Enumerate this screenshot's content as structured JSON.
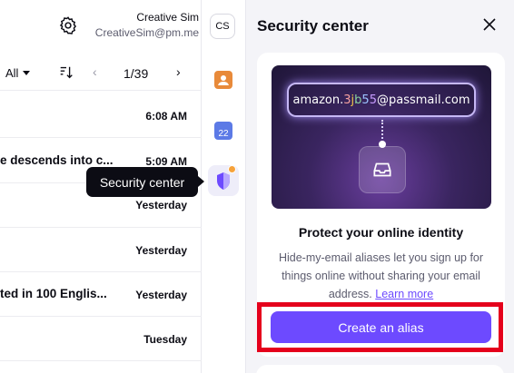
{
  "user": {
    "name": "Creative Sim",
    "email": "CreativeSim@pm.me",
    "initials": "CS"
  },
  "toolbar": {
    "filter": "All",
    "pager": "1/39",
    "prev": "‹",
    "next": "›"
  },
  "mail_rows": [
    {
      "subject": "",
      "time": "6:08 AM"
    },
    {
      "subject": "e descends into c...",
      "time": "5:09 AM"
    },
    {
      "subject": "",
      "time": "Yesterday"
    },
    {
      "subject": "",
      "time": "Yesterday"
    },
    {
      "subject": "ted in 100 Englis...",
      "time": "Yesterday"
    },
    {
      "subject": "",
      "time": "Tuesday"
    }
  ],
  "rail": {
    "calendar_day": "22"
  },
  "tooltip": "Security center",
  "panel": {
    "title": "Security center",
    "alias_prefix": "amazon.",
    "alias_chars": [
      "3",
      "j",
      "b",
      "5",
      "5"
    ],
    "alias_domain": "@passmail.com",
    "heading": "Protect your online identity",
    "body": "Hide-my-email aliases let you sign up for things online without sharing your email address.",
    "link": "Learn more",
    "cta": "Create an alias"
  },
  "colors": {
    "accent": "#6d4aff",
    "highlight": "#e5001c",
    "notification": "#f6a23a"
  }
}
